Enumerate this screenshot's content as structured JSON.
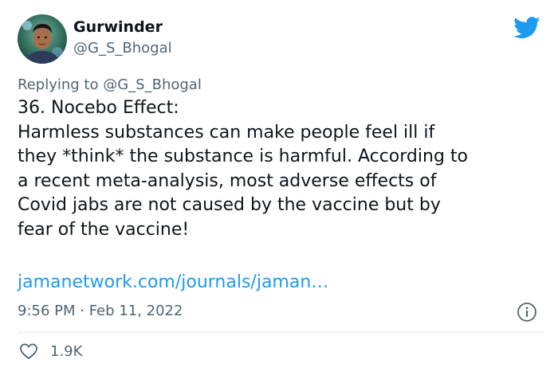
{
  "author": {
    "display_name": "Gurwinder",
    "handle": "@G_S_Bhogal"
  },
  "reply": {
    "prefix": "Replying to",
    "handle": "@G_S_Bhogal"
  },
  "tweet": {
    "body": "36. Nocebo Effect:\nHarmless substances can make people feel ill if\nthey *think* the substance is harmful. According to\na recent meta-analysis, most adverse effects of\nCovid jabs are not caused by the vaccine but by\nfear of the vaccine!",
    "link": "jamanetwork.com/journals/jaman…",
    "timestamp": "9:56 PM · Feb 11, 2022",
    "likes": "1.9K"
  },
  "icons": {
    "logo": "twitter-bird-icon",
    "info": "info-icon",
    "like": "heart-icon"
  },
  "colors": {
    "brand": "#1d9bf0",
    "link": "#1d9bf0",
    "secondary_text": "#536471",
    "primary_text": "#0f1419"
  }
}
